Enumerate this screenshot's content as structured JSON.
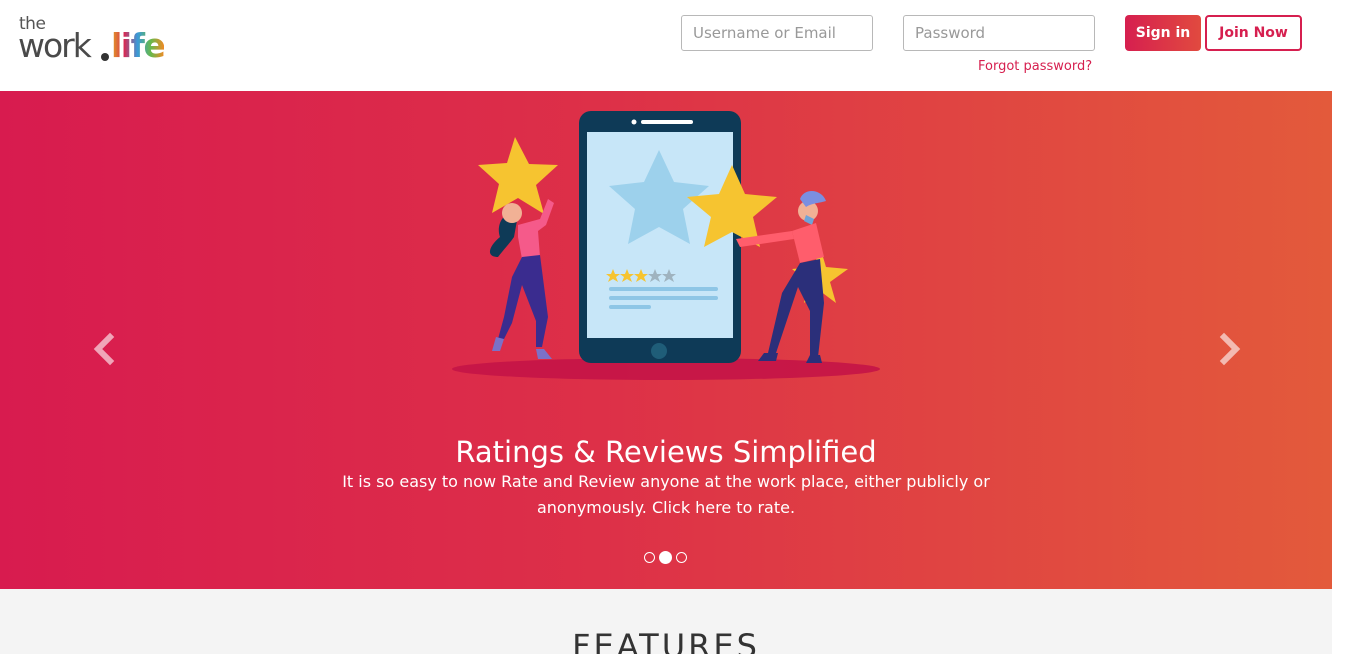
{
  "header": {
    "logo": {
      "the": "the",
      "work": "work",
      "life": "life"
    },
    "username_placeholder": "Username or Email",
    "password_placeholder": "Password",
    "forgot_label": "Forgot password?",
    "signin_label": "Sign in",
    "join_label": "Join Now"
  },
  "hero": {
    "title": "Ratings & Reviews Simplified",
    "text": "It is so easy to now Rate and Review anyone at the work place, either publicly or anonymously. Click here to rate.",
    "slides": 3,
    "active_slide": 2,
    "illustration_rating": 3,
    "illustration_rating_max": 5,
    "colors": {
      "gradient_start": "#d81b4f",
      "gradient_end": "#e35a3b",
      "accent": "#d61f4f"
    }
  },
  "features": {
    "title": "FEATURES"
  },
  "icons": [
    "chevron-left-icon",
    "chevron-right-icon"
  ]
}
